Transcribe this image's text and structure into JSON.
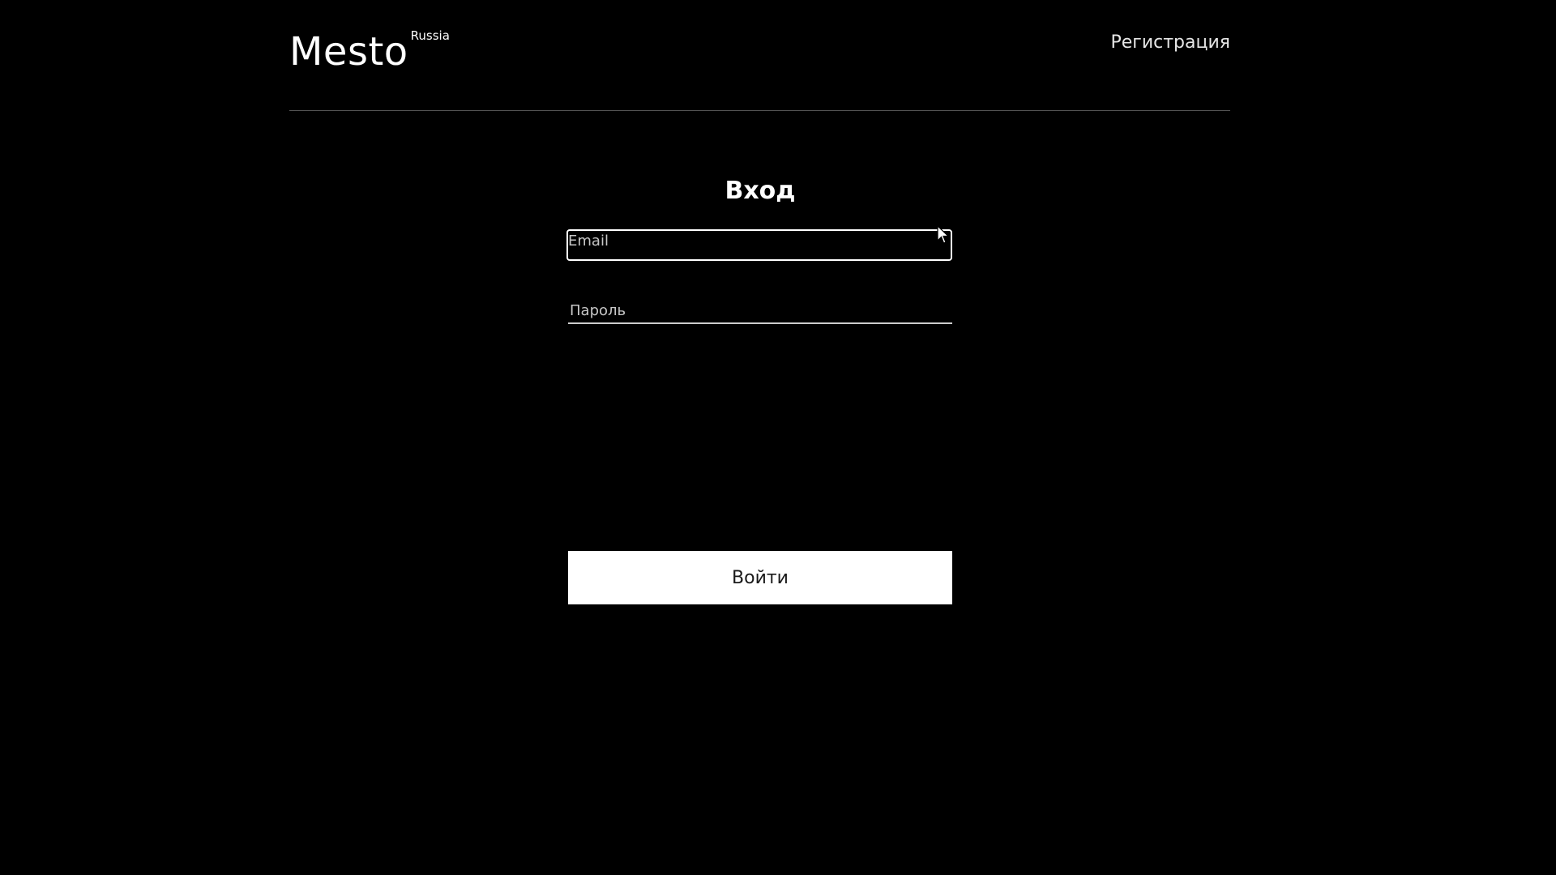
{
  "header": {
    "logo_text": "Mesto",
    "logo_sup": "Russia",
    "register_link": "Регистрация"
  },
  "auth": {
    "title": "Вход",
    "email_placeholder": "Email",
    "password_placeholder": "Пароль",
    "submit_label": "Войти"
  },
  "colors": {
    "background": "#000000",
    "text": "#ffffff",
    "button_bg": "#ffffff",
    "divider": "#545454"
  },
  "icons": {
    "cursor": "mouse-pointer-icon"
  }
}
